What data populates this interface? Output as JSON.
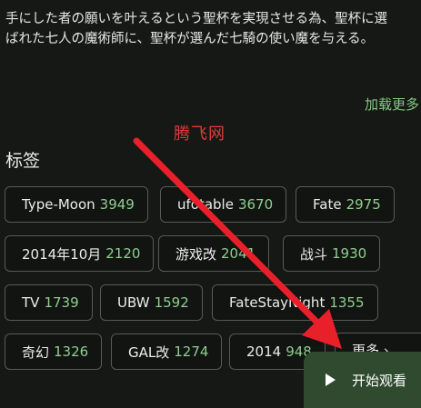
{
  "description": {
    "line1": "手にした者の願いを叶えるという聖杯を実現させる為、聖杯に選",
    "line2": "ばれた七人の魔術師に、聖杯が選んだ七騎の使い魔を与える。"
  },
  "load_more_label": "加载更多",
  "watermark_text": "腾飞网",
  "tags_title": "标签",
  "tags": [
    {
      "name": "Type-Moon",
      "count": "3949"
    },
    {
      "name": "ufotable",
      "count": "3670"
    },
    {
      "name": "Fate",
      "count": "2975"
    },
    {
      "name": "2014年10月",
      "count": "2120"
    },
    {
      "name": "游戏改",
      "count": "2041"
    },
    {
      "name": "战斗",
      "count": "1930"
    },
    {
      "name": "TV",
      "count": "1739"
    },
    {
      "name": "UBW",
      "count": "1592"
    },
    {
      "name": "FateStayNight",
      "count": "1355"
    },
    {
      "name": "奇幻",
      "count": "1326"
    },
    {
      "name": "GAL改",
      "count": "1274"
    },
    {
      "name": "2014",
      "count": "948"
    }
  ],
  "more_tags_label": "更多 ›",
  "watch_button_label": "开始观看",
  "arrow_color": "#e8202a",
  "accent_color": "#8fce8f"
}
